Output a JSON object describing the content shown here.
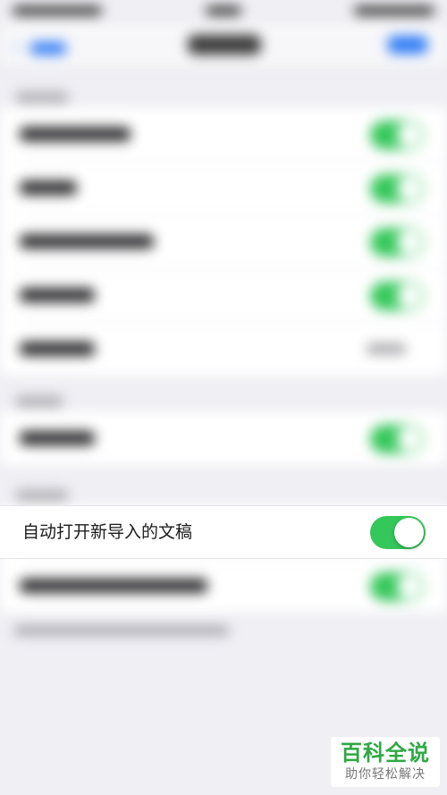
{
  "settings": {
    "highlighted_row": {
      "label": "自动打开新导入的文稿",
      "toggle_on": true
    }
  },
  "colors": {
    "toggle_on": "#34c759",
    "accent": "#2f7cf6",
    "background": "#efeff4"
  },
  "watermark": {
    "title": "百科全说",
    "subtitle": "助你轻松解决"
  }
}
